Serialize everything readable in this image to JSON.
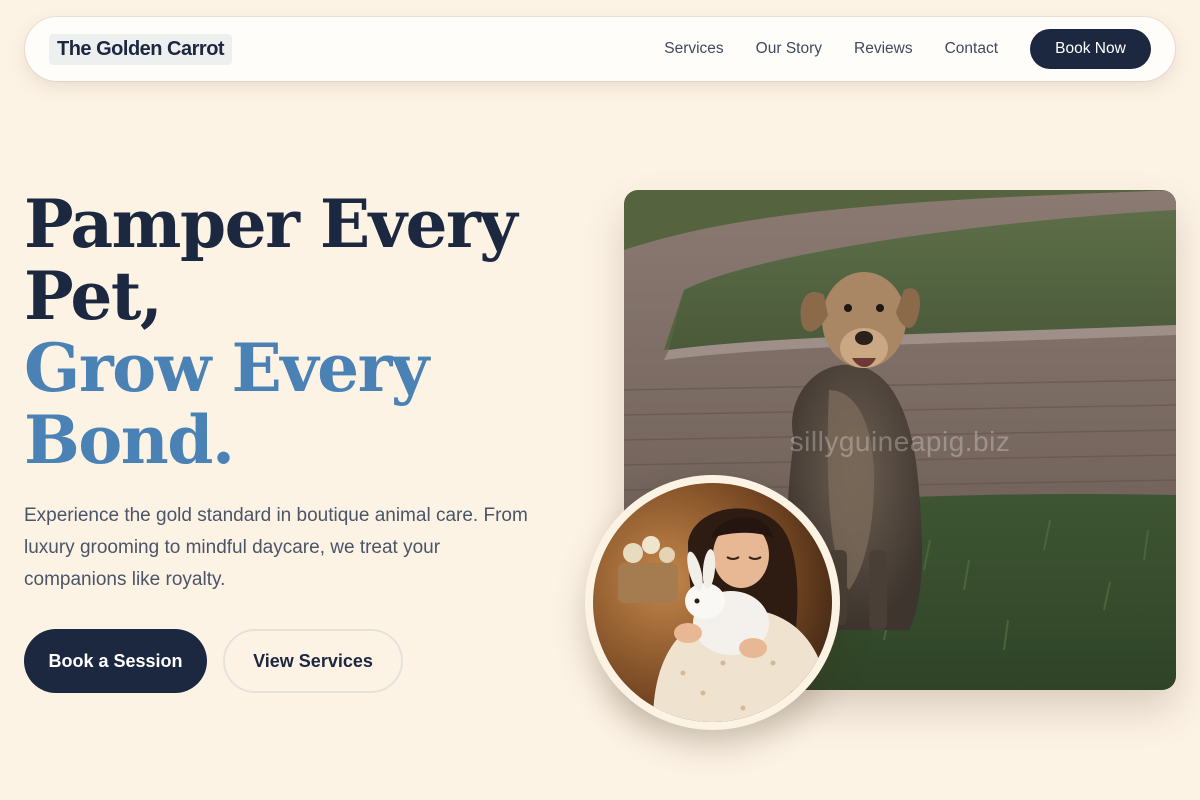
{
  "brand": {
    "name": "The Golden Carrot"
  },
  "nav": {
    "links": [
      "Services",
      "Our Story",
      "Reviews",
      "Contact"
    ],
    "cta": "Book Now"
  },
  "hero": {
    "headline_line1": "Pamper Every",
    "headline_line2": "Pet,",
    "headline_line3": "Grow Every",
    "headline_line4": "Bond.",
    "subtext": "Experience the gold standard in boutique animal care. From luxury grooming to mindful daycare, we treat your companions like royalty.",
    "primary_button": "Book a Session",
    "secondary_button": "View Services"
  },
  "photos": {
    "main_watermark": "sillyguineapig.biz",
    "main_subject": "dog-sitting-on-grass",
    "inset_subject": "woman-hugging-white-rabbit"
  },
  "colors": {
    "background": "#fdf3e5",
    "navy": "#1c2740",
    "accent_blue": "#4a82b5"
  }
}
